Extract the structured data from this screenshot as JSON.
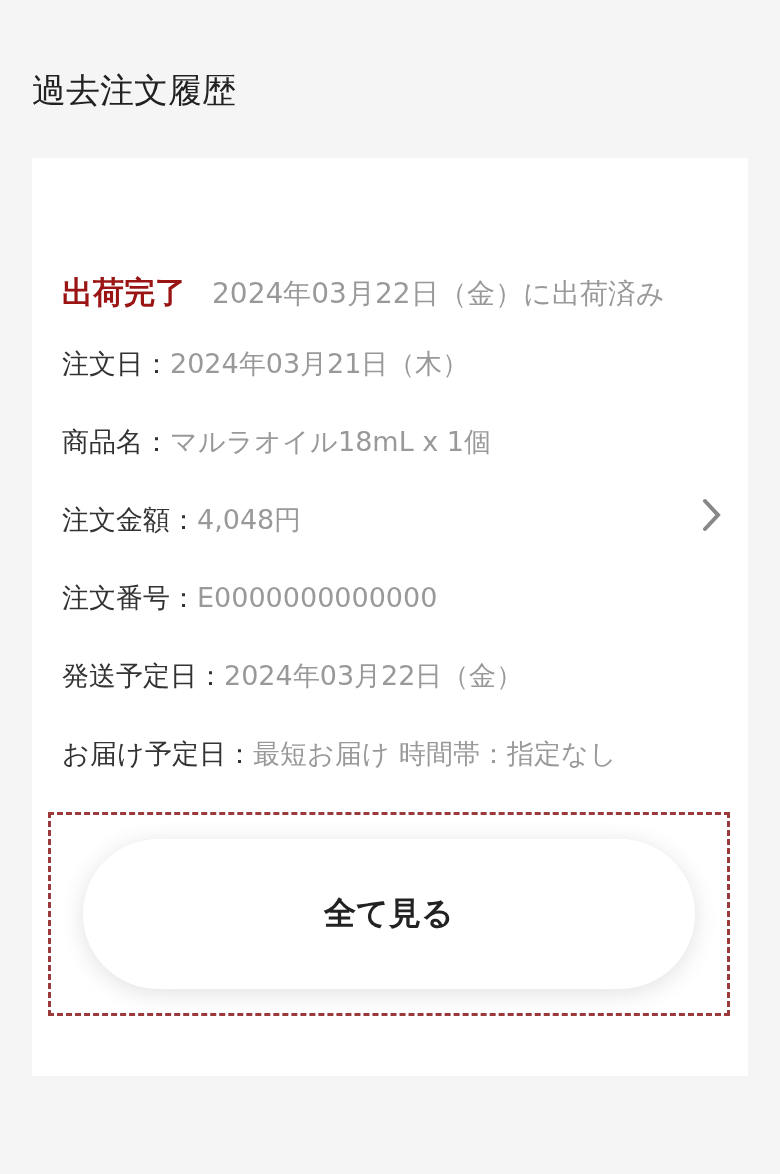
{
  "page_title": "過去注文履歴",
  "order": {
    "status": "出荷完了",
    "status_note": "2024年03月22日（金）に出荷済み",
    "details": [
      {
        "label": "注文日：",
        "value": "2024年03月21日（木）"
      },
      {
        "label": "商品名：",
        "value": "マルラオイル18mL x 1個"
      },
      {
        "label": "注文金額：",
        "value": "4,048円"
      },
      {
        "label": "注文番号：",
        "value": "E0000000000000"
      },
      {
        "label": "発送予定日：",
        "value": "2024年03月22日（金）"
      },
      {
        "label": "お届け予定日：",
        "value": "最短お届け 時間帯：指定なし"
      }
    ]
  },
  "view_all_button": {
    "label": "全て見る",
    "focused": true
  }
}
